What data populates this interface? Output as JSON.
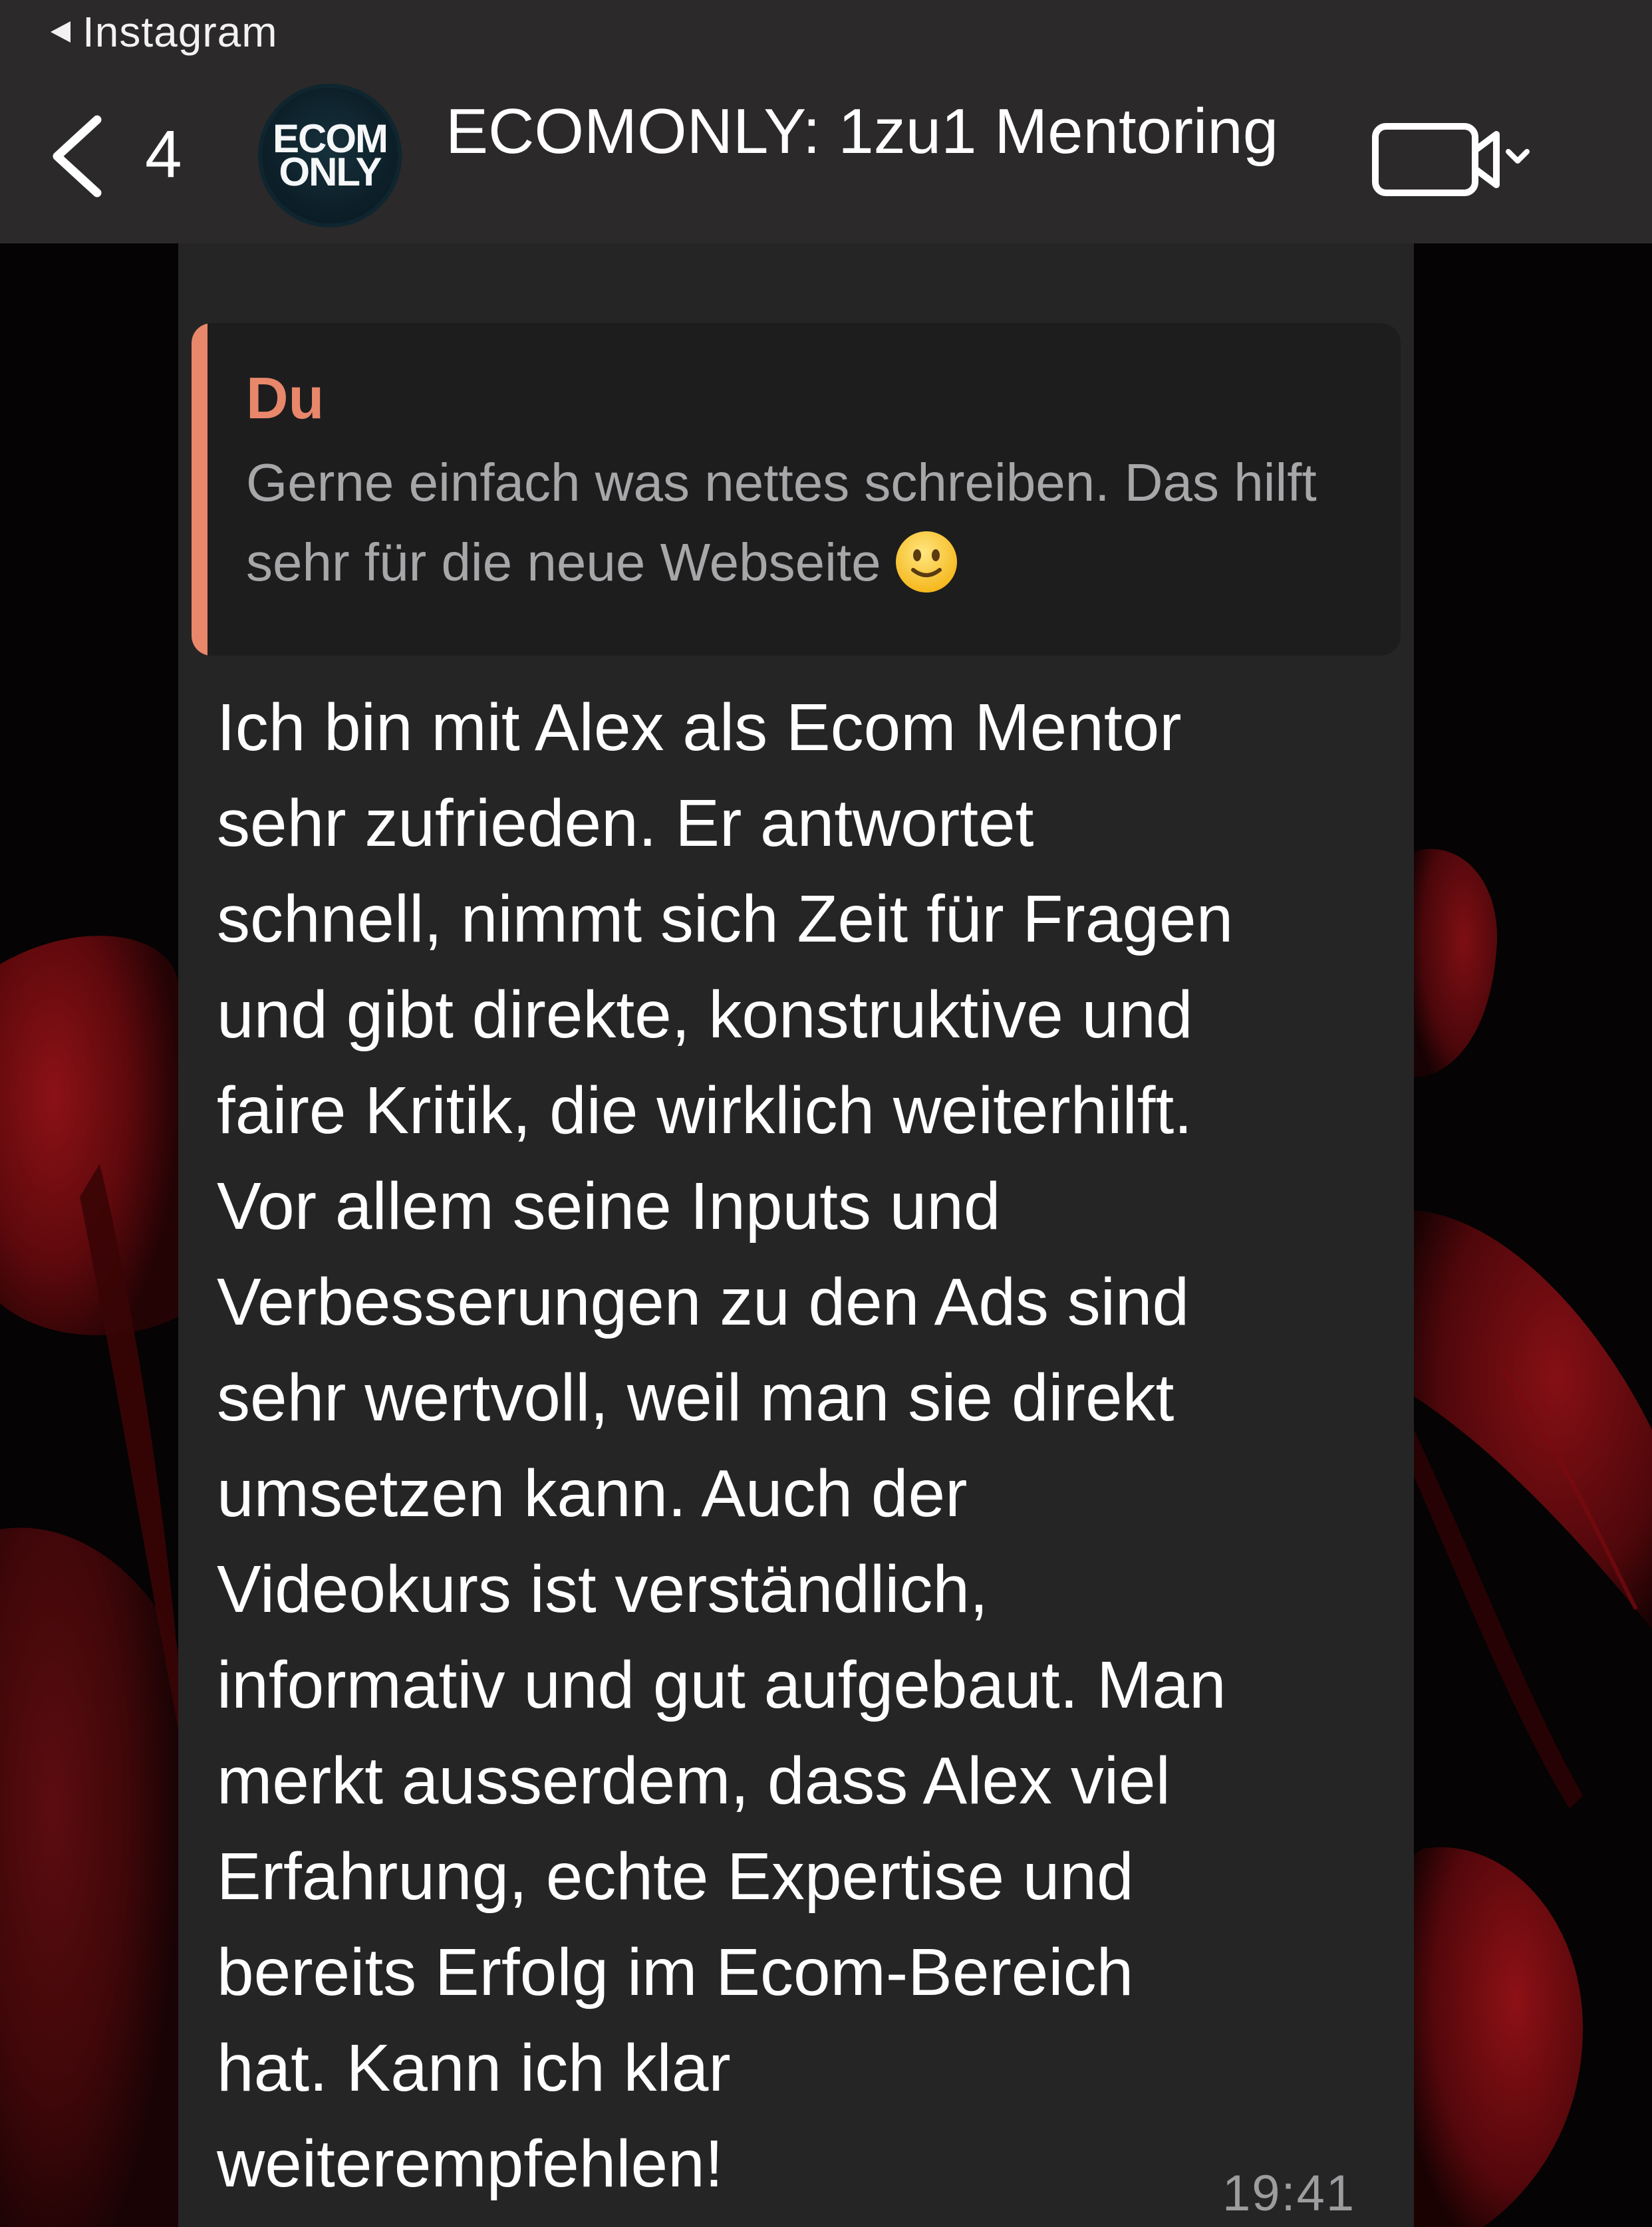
{
  "status_bar": {
    "back_app_label": "Instagram"
  },
  "header": {
    "unread_count": "4",
    "avatar_text_line1": "ECOM",
    "avatar_text_line2": "ONLY",
    "title": "ECOMONLY: 1zu1 Mentoring"
  },
  "message": {
    "reply": {
      "author": "Du",
      "text": "Gerne einfach was nettes schreiben. Das hilft sehr für die neue Webseite"
    },
    "body_lines": [
      "Ich bin mit Alex als Ecom Mentor",
      "sehr zufrieden. Er antwortet",
      "schnell, nimmt sich Zeit für Fragen",
      "und gibt direkte, konstruktive und",
      "faire Kritik, die wirklich weiterhilft.",
      "Vor allem seine Inputs und",
      "Verbesserungen zu den Ads sind",
      "sehr wertvoll, weil man sie direkt",
      "umsetzen kann. Auch der",
      "Videokurs ist verständlich,",
      "informativ und gut aufgebaut. Man",
      "merkt ausserdem, dass Alex viel",
      "Erfahrung, echte Expertise und",
      "bereits Erfolg im Ecom-Bereich",
      "hat. Kann ich klar",
      "weiterempfehlen!"
    ],
    "time": "19:41"
  },
  "icons": {
    "back": "chevron-left-icon",
    "return_to_app": "triangle-left-icon",
    "video": "video-camera-icon",
    "dropdown": "chevron-down-icon",
    "emoji": "slightly-smiling-face-icon"
  },
  "colors": {
    "header_bg": "#2b2929",
    "bubble_bg": "#252526",
    "quote_bg": "#1d1d1e",
    "quote_accent": "#e8876a",
    "text_primary": "#ffffff",
    "text_secondary": "#a7a7a9",
    "wallpaper_red": "#8a0d12"
  }
}
